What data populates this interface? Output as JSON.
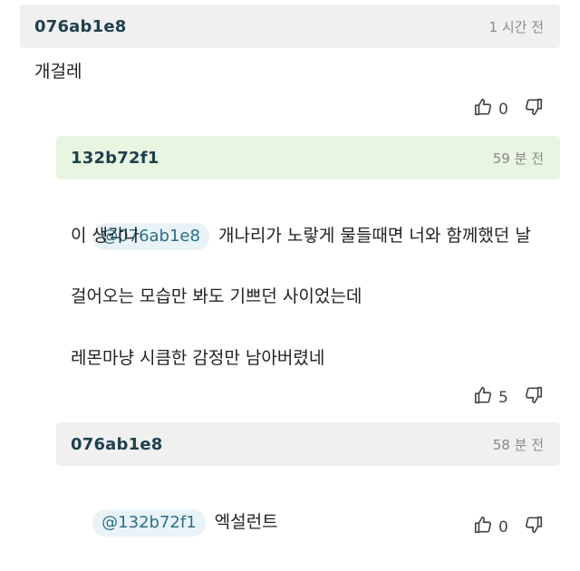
{
  "comments": [
    {
      "author": "076ab1e8",
      "time": "1 시간 전",
      "lines": [
        "개걸레"
      ],
      "likes": "0"
    },
    {
      "author": "132b72f1",
      "time": "59 분 전",
      "mention": "@076ab1e8",
      "first_line": "개나리가 노랗게 물들때면 너와 함께했던 날",
      "lines": [
        "이 생각나",
        "걸어오는 모습만 봐도 기쁘던 사이었는데",
        "레몬마냥 시큼한 감정만 남아버렸네"
      ],
      "likes": "5"
    },
    {
      "author": "076ab1e8",
      "time": "58 분 전",
      "mention": "@132b72f1",
      "first_line": "엑설런트",
      "likes": "0"
    }
  ]
}
